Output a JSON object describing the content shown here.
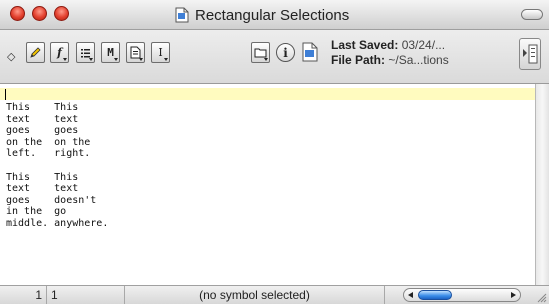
{
  "window": {
    "title": "Rectangular Selections",
    "title_icon": "document-icon"
  },
  "toolbar": {
    "buttons": [
      {
        "name": "marker-button",
        "glyph": "pencil-icon"
      },
      {
        "name": "function-menu-button",
        "glyph": "f"
      },
      {
        "name": "list-menu-button",
        "glyph": "list-icon"
      },
      {
        "name": "marks-menu-button",
        "glyph": "M"
      },
      {
        "name": "document-menu-button",
        "glyph": "doc-icon"
      },
      {
        "name": "text-menu-button",
        "glyph": "I"
      },
      {
        "name": "folder-menu-button",
        "glyph": "folder-icon"
      }
    ],
    "info_button_glyph": "i",
    "last_saved_label": "Last Saved:",
    "last_saved_value": "03/24/...",
    "file_path_label": "File Path:",
    "file_path_value": "~/Sa...tions"
  },
  "editor": {
    "text": "This    This\ntext    text\ngoes    goes\non the  on the\nleft.   right.\n\nThis    This\ntext    text\ngoes    doesn't\nin the  go\nmiddle. anywhere.",
    "highlight_color": "#fffbbf"
  },
  "status": {
    "line": "1",
    "column": "1",
    "symbol": "(no symbol selected)"
  },
  "colors": {
    "close_button": "#e2402e",
    "scroll_thumb": "#3a8ce8"
  }
}
